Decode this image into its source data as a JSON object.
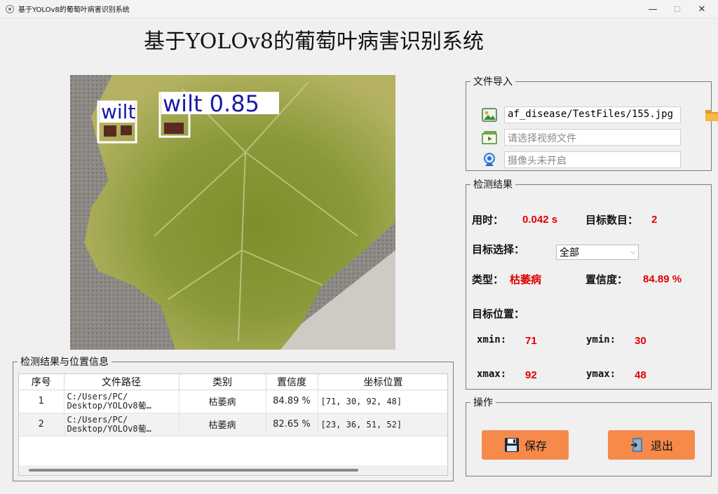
{
  "window": {
    "title": "基于YOLOv8的葡萄叶病害识别系统",
    "minimize": "—",
    "maximize": "☐",
    "close": "✕"
  },
  "main_title": "基于YOLOv8的葡萄叶病害识别系统",
  "image": {
    "detections": [
      {
        "label": "wilt",
        "conf_text": ""
      },
      {
        "label": "wilt 0.85"
      }
    ]
  },
  "file_import": {
    "legend": "文件导入",
    "image_path": "af_disease/TestFiles/155.jpg",
    "video_placeholder": "请选择视频文件",
    "camera_placeholder": "摄像头未开启",
    "icons": {
      "image": "image-file-icon",
      "video": "video-file-icon",
      "camera": "webcam-icon",
      "folder": "folder-icon"
    }
  },
  "result": {
    "legend": "检测结果",
    "time_label": "用时：",
    "time_value": "0.042 s",
    "count_label": "目标数目：",
    "count_value": "2",
    "select_label": "目标选择：",
    "select_value": "全部",
    "type_label": "类型：",
    "type_value": "枯萎病",
    "conf_label": "置信度：",
    "conf_value": "84.89 %",
    "position_label": "目标位置：",
    "xmin_label": "xmin:",
    "xmin_value": "71",
    "ymin_label": "ymin:",
    "ymin_value": "30",
    "xmax_label": "xmax:",
    "xmax_value": "92",
    "ymax_label": "ymax:",
    "ymax_value": "48",
    "accent_color": "#e00000"
  },
  "operations": {
    "legend": "操作",
    "save_label": "保存",
    "exit_label": "退出",
    "button_color": "#f58a4a"
  },
  "table": {
    "legend": "检测结果与位置信息",
    "headers": [
      "序号",
      "文件路径",
      "类别",
      "置信度",
      "坐标位置"
    ],
    "rows": [
      {
        "index": "1",
        "path_line1": "C:/Users/PC/",
        "path_line2": "Desktop/YOLOv8葡…",
        "category": "枯萎病",
        "confidence": "84.89 %",
        "coords": "[71, 30, 92, 48]"
      },
      {
        "index": "2",
        "path_line1": "C:/Users/PC/",
        "path_line2": "Desktop/YOLOv8葡…",
        "category": "枯萎病",
        "confidence": "82.65 %",
        "coords": "[23, 36, 51, 52]"
      }
    ]
  }
}
